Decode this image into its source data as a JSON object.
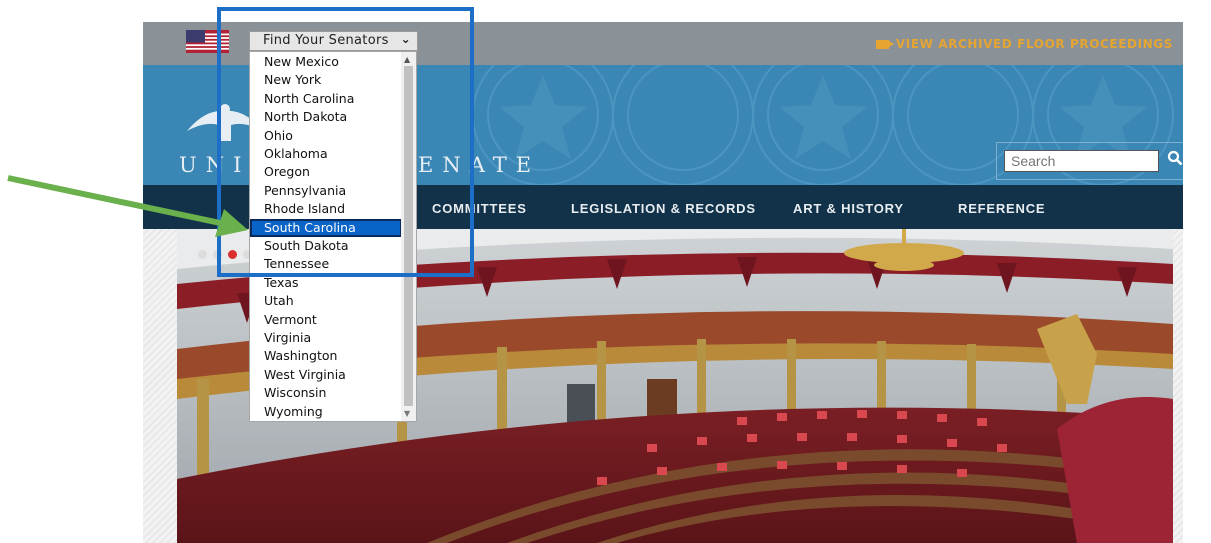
{
  "topbar": {
    "senators_select_label": "Find Your Senators",
    "archived_link": "VIEW ARCHIVED FLOOR PROCEEDINGS"
  },
  "header": {
    "brand_left": "UNIT",
    "brand_right": "ENATE",
    "search_placeholder": "Search"
  },
  "nav": {
    "items": [
      {
        "label": "COMMITTEES"
      },
      {
        "label": "LEGISLATION & RECORDS"
      },
      {
        "label": "ART & HISTORY"
      },
      {
        "label": "REFERENCE"
      }
    ]
  },
  "dropdown": {
    "options": [
      "New Mexico",
      "New York",
      "North Carolina",
      "North Dakota",
      "Ohio",
      "Oklahoma",
      "Oregon",
      "Pennsylvania",
      "Rhode Island",
      "South Carolina",
      "South Dakota",
      "Tennessee",
      "Texas",
      "Utah",
      "Vermont",
      "Virginia",
      "Washington",
      "West Virginia",
      "Wisconsin",
      "Wyoming"
    ],
    "selected": "South Carolina"
  },
  "colors": {
    "header_blue": "#3a87b5",
    "nav_dark": "#113249",
    "accent_orange": "#e6a531",
    "highlight_blue": "#1c6ec7",
    "arrow_green": "#6ab04c",
    "selected_option": "#0a63c7"
  },
  "icons": {
    "flag": "us-flag-icon",
    "camera": "video-camera-icon",
    "search": "search-icon",
    "chevron": "chevron-down-icon"
  }
}
